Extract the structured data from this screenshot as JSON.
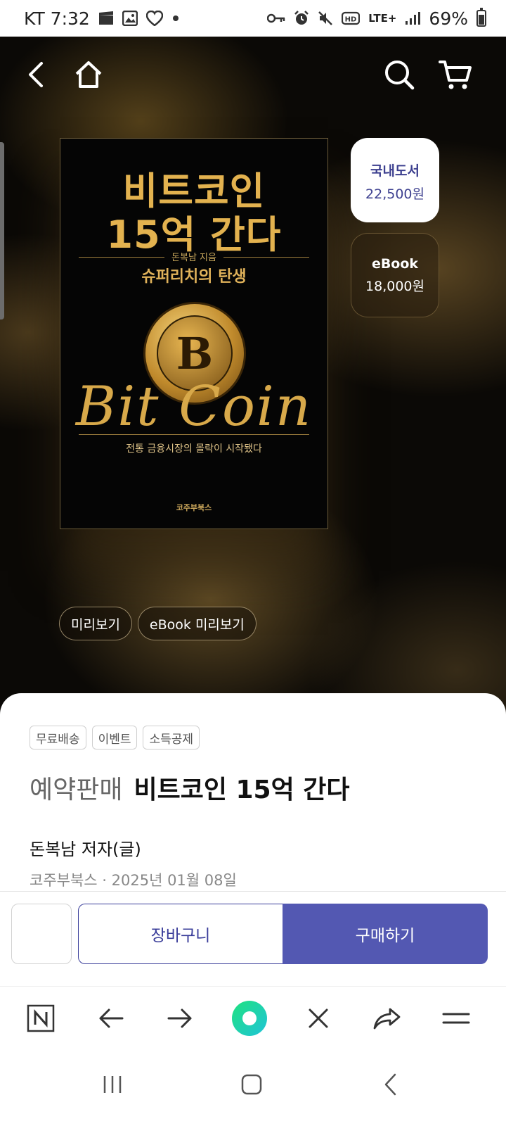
{
  "status_bar": {
    "carrier_time": "KT 7:32",
    "network": "LTE+",
    "battery": "69%"
  },
  "hero": {
    "cover": {
      "title_line1": "비트코인",
      "title_line2": "15억 간다",
      "author": "돈복남 지음",
      "subtitle": "슈퍼리치의 탄생",
      "coin_symbol": "B",
      "script_text": "Bit Coin",
      "tagline": "전통 금융시장의 몰락이 시작됐다",
      "publisher": "코주부북스"
    },
    "formats": [
      {
        "label": "국내도서",
        "price": "22,500원",
        "selected": true
      },
      {
        "label": "eBook",
        "price": "18,000원",
        "selected": false
      }
    ],
    "preview_buttons": [
      "미리보기",
      "eBook 미리보기"
    ]
  },
  "product": {
    "tags": [
      "무료배송",
      "이벤트",
      "소득공제"
    ],
    "sale_status": "예약판매",
    "title": "비트코인 15억 간다",
    "author": "돈복남 저자(글)",
    "publisher_date": "코주부북스 · 2025년 01월 08일"
  },
  "actions": {
    "cart_label": "장바구니",
    "buy_label": "구매하기"
  },
  "icons": {
    "back": "chevron-left-icon",
    "home": "home-icon",
    "search": "search-icon",
    "cart": "cart-icon"
  },
  "colors": {
    "accent": "#5358b2",
    "accent_text": "#3a3d9a",
    "gold": "#e3b24f",
    "browser_green": "#21d4a4"
  }
}
